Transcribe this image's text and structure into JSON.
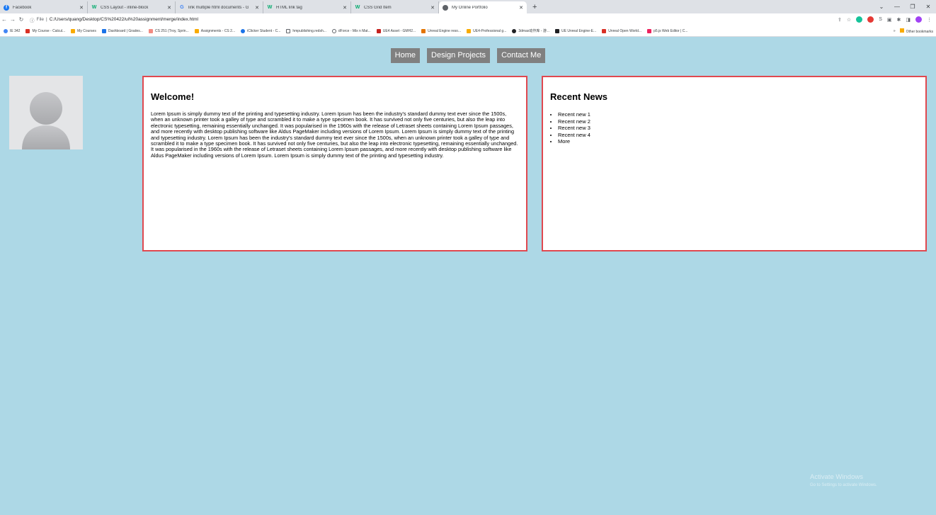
{
  "browser": {
    "tabs": [
      {
        "title": "Facebook",
        "color": "#1877f2",
        "glyph": "f"
      },
      {
        "title": "CSS Layout - inline-block",
        "color": "#04aa6d",
        "glyph": "W"
      },
      {
        "title": "link multiple html documents - G",
        "color": "#4285f4",
        "glyph": "G"
      },
      {
        "title": "HTML link tag",
        "color": "#04aa6d",
        "glyph": "W"
      },
      {
        "title": "CSS Grid Item",
        "color": "#04aa6d",
        "glyph": "W"
      },
      {
        "title": "My Online Portfolio",
        "color": "#5f6368",
        "glyph": ""
      }
    ],
    "address": {
      "scheme_label": "File",
      "url": "C:/Users/quang/Desktop/CS%20422/ui%20assignment/merge/index.html"
    },
    "bookmarks": [
      {
        "label": "IE 342",
        "color": "#4285f4"
      },
      {
        "label": "My Course - Calcul...",
        "color": "#d93025"
      },
      {
        "label": "My Courses",
        "color": "#f9ab00"
      },
      {
        "label": "Dashboard | Grades...",
        "color": "#1a73e8"
      },
      {
        "label": "CS 251 (Troy, Sprin...",
        "color": "#f28b82"
      },
      {
        "label": "Assignments - CS 2...",
        "color": "#f9ab00"
      },
      {
        "label": "iClicker Student - C...",
        "color": "#1a73e8"
      },
      {
        "label": "hmpublishing.redsh...",
        "color": "#5f6368"
      },
      {
        "label": "dForce - Mix n Mat...",
        "color": "#5f6368"
      },
      {
        "label": "UE4 Asset - GMH2...",
        "color": "#c5221f"
      },
      {
        "label": "Unreal Engine reso...",
        "color": "#e37400"
      },
      {
        "label": "UE4-Professional g...",
        "color": "#f9ab00"
      },
      {
        "label": "3dmax动作库 - 游...",
        "color": "#202124"
      },
      {
        "label": "UE Unreal Engine-E...",
        "color": "#202124"
      },
      {
        "label": "Unreal Open World...",
        "color": "#d93025"
      },
      {
        "label": "p5.js Web Editor | C...",
        "color": "#ed225d"
      }
    ],
    "other_bookmarks": "Other bookmarks"
  },
  "nav": {
    "home": "Home",
    "design_projects": "Design Projects",
    "contact": "Contact Me"
  },
  "welcome": {
    "heading": "Welcome!",
    "body": "Lorem Ipsum is simply dummy text of the printing and typesetting industry. Lorem Ipsum has been the industry's standard dummy text ever since the 1500s, when an unknown printer took a galley of type and scrambled it to make a type specimen book. It has survived not only five centuries, but also the leap into electronic typesetting, remaining essentially unchanged. It was popularised in the 1960s with the release of Letraset sheets containing Lorem Ipsum passages, and more recently with desktop publishing software like Aldus PageMaker including versions of Lorem Ipsum. Lorem Ipsum is simply dummy text of the printing and typesetting industry. Lorem Ipsum has been the industry's standard dummy text ever since the 1500s, when an unknown printer took a galley of type and scrambled it to make a type specimen book. It has survived not only five centuries, but also the leap into electronic typesetting, remaining essentially unchanged. It was popularised in the 1960s with the release of Letraset sheets containing Lorem Ipsum passages, and more recently with desktop publishing software like Aldus PageMaker including versions of Lorem Ipsum. Lorem Ipsum is simply dummy text of the printing and typesetting industry."
  },
  "news": {
    "heading": "Recent News",
    "items": [
      "Recent new 1",
      "Recent new 2",
      "Recent new 3",
      "Recent new 4",
      "More"
    ]
  },
  "watermark": {
    "line1": "Activate Windows",
    "line2": "Go to Settings to activate Windows."
  },
  "colors": {
    "page_bg": "#add8e6",
    "nav_button": "#808080",
    "panel_border": "#e0484f"
  }
}
